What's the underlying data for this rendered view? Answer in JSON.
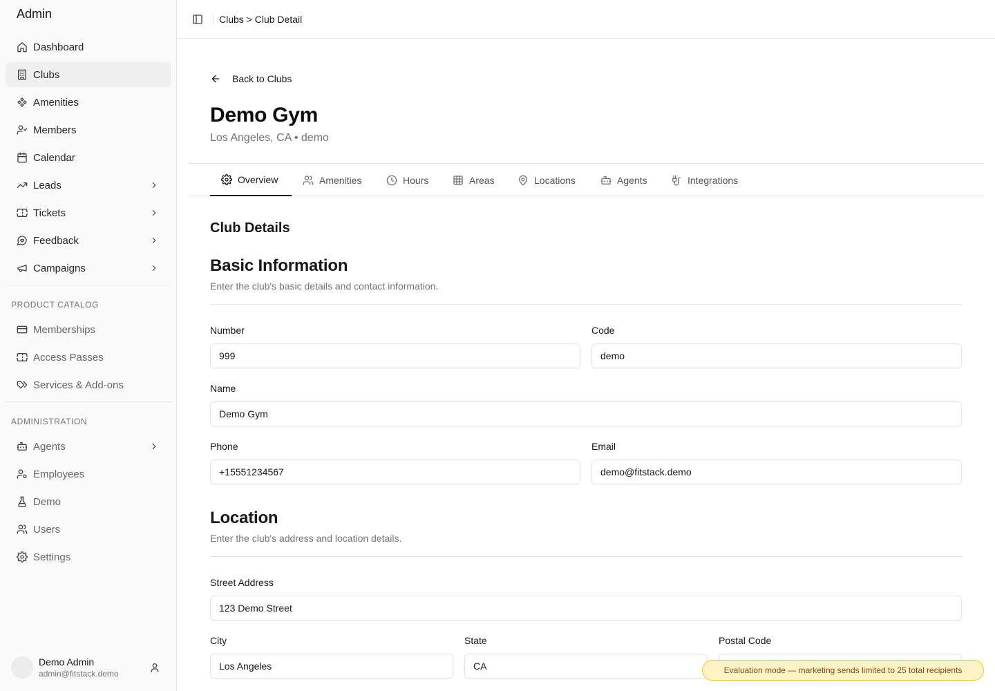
{
  "app": {
    "brand": "Admin"
  },
  "sidebar": {
    "items": [
      {
        "label": "Dashboard",
        "icon": "home-icon"
      },
      {
        "label": "Clubs",
        "icon": "building-icon",
        "active": true
      },
      {
        "label": "Amenities",
        "icon": "amenities-icon"
      },
      {
        "label": "Members",
        "icon": "user-check-icon"
      },
      {
        "label": "Calendar",
        "icon": "calendar-icon"
      },
      {
        "label": "Leads",
        "icon": "trending-up-icon",
        "expandable": true
      },
      {
        "label": "Tickets",
        "icon": "ticket-icon",
        "expandable": true
      },
      {
        "label": "Feedback",
        "icon": "message-heart-icon",
        "expandable": true
      },
      {
        "label": "Campaigns",
        "icon": "megaphone-icon",
        "expandable": true
      }
    ],
    "product_catalog": {
      "label": "PRODUCT CATALOG",
      "items": [
        {
          "label": "Memberships",
          "icon": "credit-card-icon"
        },
        {
          "label": "Access Passes",
          "icon": "ticket-icon"
        },
        {
          "label": "Services & Add-ons",
          "icon": "tags-icon"
        }
      ]
    },
    "administration": {
      "label": "ADMINISTRATION",
      "items": [
        {
          "label": "Agents",
          "icon": "bot-icon",
          "expandable": true
        },
        {
          "label": "Employees",
          "icon": "users-cog-icon"
        },
        {
          "label": "Demo",
          "icon": "flask-icon"
        },
        {
          "label": "Users",
          "icon": "users-icon"
        },
        {
          "label": "Settings",
          "icon": "gear-icon"
        }
      ]
    },
    "user": {
      "name": "Demo Admin",
      "email": "admin@fitstack.demo"
    }
  },
  "header": {
    "breadcrumb": "Clubs > Club Detail"
  },
  "page": {
    "back_label": "Back to Clubs",
    "title": "Demo Gym",
    "subtitle": "Los Angeles, CA • demo",
    "tabs": [
      {
        "label": "Overview",
        "icon": "gear-icon",
        "active": true
      },
      {
        "label": "Amenities",
        "icon": "users-icon"
      },
      {
        "label": "Hours",
        "icon": "clock-icon"
      },
      {
        "label": "Areas",
        "icon": "grid-icon"
      },
      {
        "label": "Locations",
        "icon": "map-pin-icon"
      },
      {
        "label": "Agents",
        "icon": "bot-icon"
      },
      {
        "label": "Integrations",
        "icon": "plug-icon"
      }
    ],
    "section_title": "Club Details",
    "basic": {
      "title": "Basic Information",
      "description": "Enter the club's basic details and contact information.",
      "number_label": "Number",
      "number_value": "999",
      "code_label": "Code",
      "code_value": "demo",
      "name_label": "Name",
      "name_value": "Demo Gym",
      "phone_label": "Phone",
      "phone_value": "+15551234567",
      "email_label": "Email",
      "email_value": "demo@fitstack.demo"
    },
    "location": {
      "title": "Location",
      "description": "Enter the club's address and location details.",
      "street_label": "Street Address",
      "street_value": "123 Demo Street",
      "city_label": "City",
      "city_value": "Los Angeles",
      "state_label": "State",
      "state_value": "CA",
      "postal_label": "Postal Code",
      "postal_value": ""
    }
  },
  "toast": {
    "text": "Evaluation mode — marketing sends limited to 25 total recipients"
  }
}
